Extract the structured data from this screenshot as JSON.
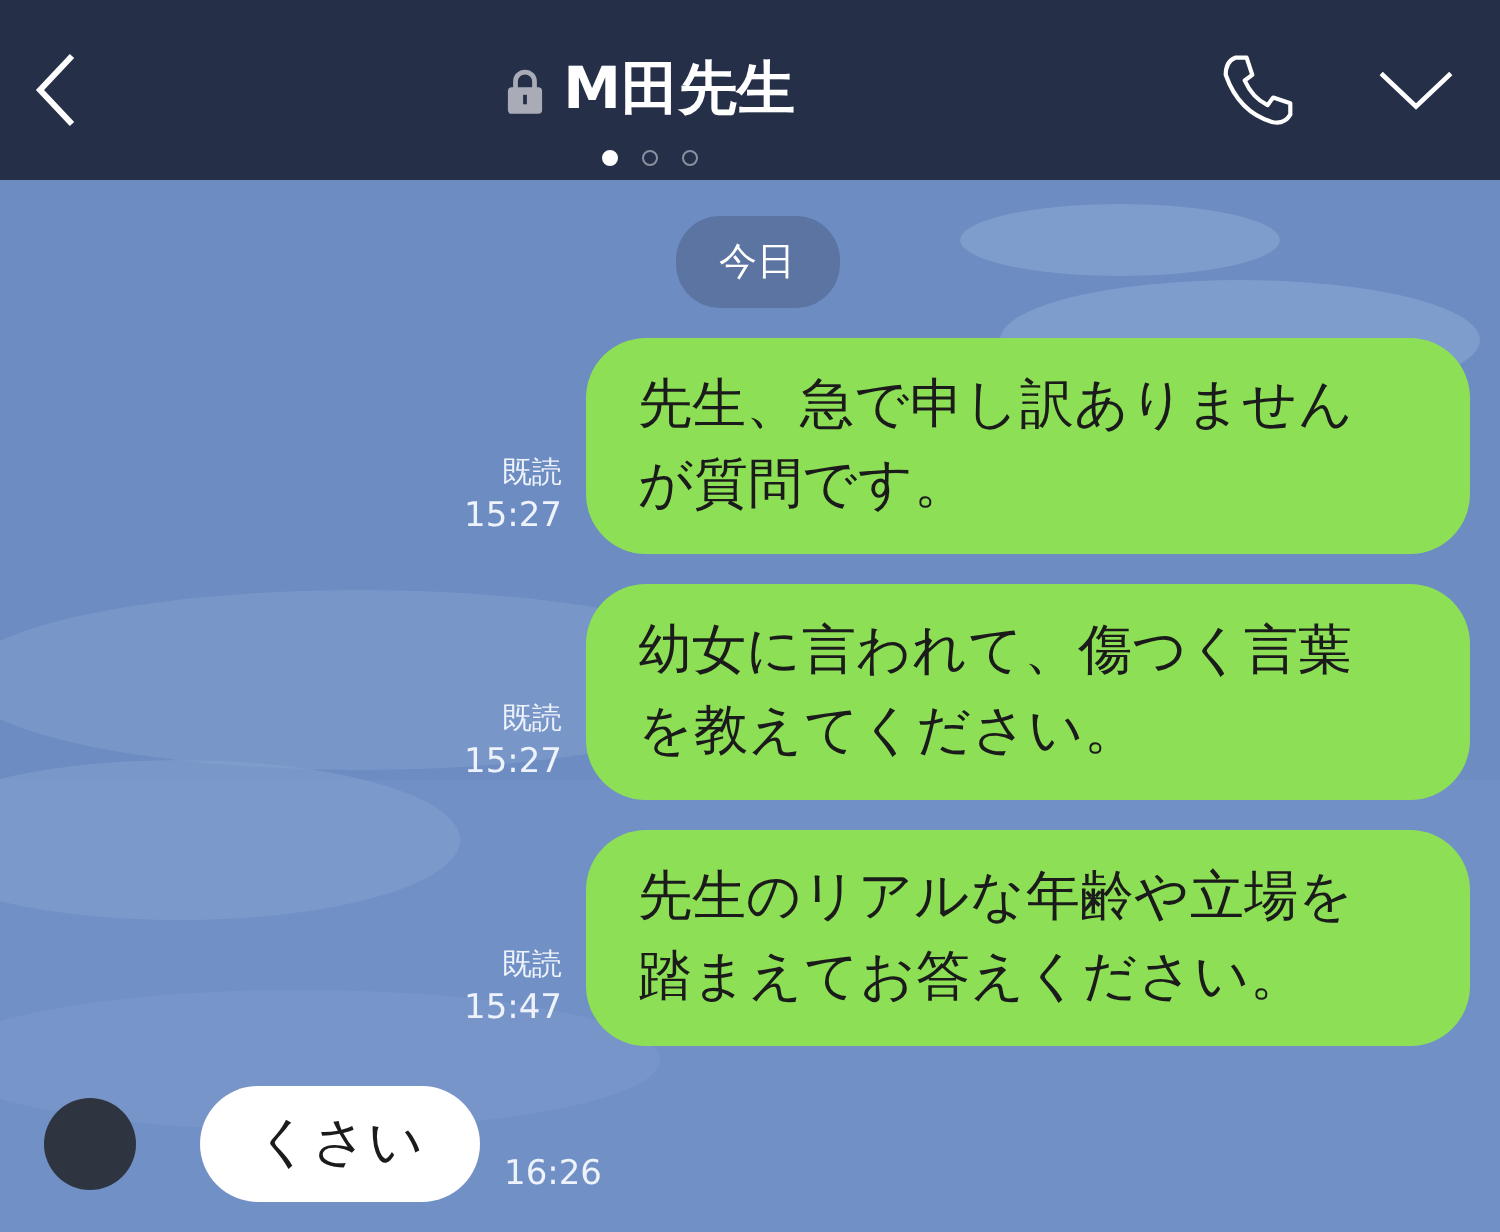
{
  "header": {
    "title": "M田先生",
    "page_dots": [
      {
        "selected": true
      },
      {
        "selected": false
      },
      {
        "selected": false
      }
    ]
  },
  "date_label": "今日",
  "messages": [
    {
      "kind": "sent",
      "text": "先生、急で申し訳ありませんが質問です。",
      "read": "既読",
      "time": "15:27"
    },
    {
      "kind": "sent",
      "text": "幼女に言われて、傷つく言葉を教えてください。",
      "read": "既読",
      "time": "15:27"
    },
    {
      "kind": "sent",
      "text": "先生のリアルな年齢や立場を踏まえてお答えください。",
      "read": "既読",
      "time": "15:47"
    },
    {
      "kind": "received",
      "text": "くさい",
      "time": "16:26"
    }
  ]
}
